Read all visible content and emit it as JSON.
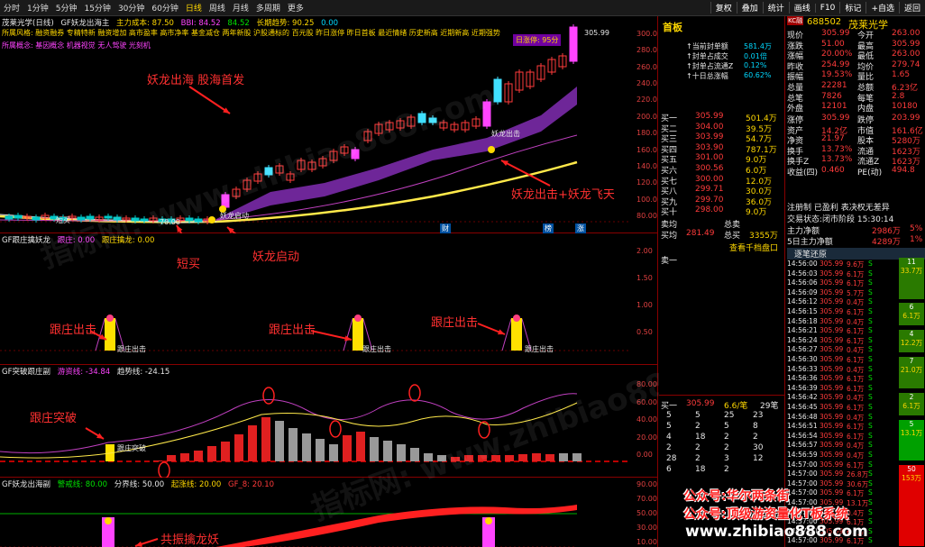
{
  "toolbar": {
    "periods": [
      "分时",
      "1分钟",
      "5分钟",
      "15分钟",
      "30分钟",
      "60分钟",
      "日线",
      "周线",
      "月线",
      "多周期",
      "更多"
    ],
    "active_period": "日线",
    "right_items": [
      "复权",
      "叠加",
      "统计",
      "画线",
      "F10",
      "标记",
      "+自选",
      "返回"
    ]
  },
  "main_panel": {
    "stock_label": "茂莱光学(日线)",
    "indicator_name": "GF妖龙出海主",
    "cost_label": "主力成本: 87.50",
    "bbi_label": "BBI: 84.52",
    "ma_value": "84.52",
    "trend_label": "长期趋势: 90.25",
    "trend_value": "0.00",
    "style_line": "所属风格: 融资融券 专精特新 融资增加 高市盈率 高市净率 基金减仓 两年新股 沪股通标的 百元股 昨日涨停 昨日首板 最近情绪 历史新高 近期新高 近期强势",
    "concept_line": "所属概念: 基因概念 机器视觉 无人驾驶 光刻机",
    "limit_badge": "日涨停: 95分",
    "y_ticks": [
      "300.0",
      "280.0",
      "260.0",
      "240.0",
      "220.0",
      "200.0",
      "180.0",
      "160.0",
      "140.0",
      "120.0",
      "100.0",
      "80.00"
    ],
    "peak_price": "305.99",
    "low_label": "70.00",
    "buy_mark": "短买",
    "start_mark": "妖龙启动",
    "strike_mark": "妖龙出击",
    "annotations": {
      "headline": "妖龙出海 股海首发",
      "short_buy": "短买",
      "dragon_start": "妖龙启动",
      "dragon_fly": "妖龙出击+妖龙飞天"
    },
    "bottom_markers": [
      "财",
      "榜",
      "涨"
    ]
  },
  "panel2": {
    "title": "GF跟庄擒妖龙",
    "sub1": "跟庄: 0.00",
    "sub2": "跟庄擒龙: 0.00",
    "y_ticks": [
      "2.00",
      "1.50",
      "1.00",
      "0.50"
    ],
    "bar_label": "跟庄出击",
    "annotation": "跟庄出击"
  },
  "panel3": {
    "title": "GF突破跟庄副",
    "sub1": "游资线: -34.84",
    "sub2": "趋势线: -24.15",
    "y_ticks": [
      "80.00",
      "60.00",
      "40.00",
      "20.00",
      "0.00"
    ],
    "bar_label": "跟庄突破",
    "annotation": "跟庄突破"
  },
  "panel4": {
    "title": "GF妖龙出海副",
    "sub1": "警戒线: 80.00",
    "sub2": "分界线: 50.00",
    "sub3": "起涨线: 20.00",
    "sub4": "GF_8: 20.10",
    "y_ticks": [
      "90.00",
      "70.00",
      "50.00",
      "30.00",
      "10.00"
    ],
    "annotation": "共振擒龙妖"
  },
  "quote": {
    "badge": "KC融",
    "code": "688502",
    "name": "茂莱光学",
    "tag": "首板",
    "stats": [
      {
        "label": "当前封单额",
        "value": "581.4万"
      },
      {
        "label": "封单占成交",
        "value": "0.01倍"
      },
      {
        "label": "封单占流通Z",
        "value": "0.12%"
      },
      {
        "label": "十日总涨幅",
        "value": "60.62%"
      }
    ],
    "sells": [
      {
        "label": "卖十",
        "price": "",
        "vol": ""
      },
      {
        "label": "卖九",
        "price": "",
        "vol": ""
      },
      {
        "label": "卖八",
        "price": "",
        "vol": ""
      },
      {
        "label": "卖七",
        "price": "",
        "vol": ""
      },
      {
        "label": "卖六",
        "price": "",
        "vol": ""
      },
      {
        "label": "卖五",
        "price": "",
        "vol": ""
      },
      {
        "label": "卖四",
        "price": "",
        "vol": ""
      },
      {
        "label": "卖三",
        "price": "",
        "vol": ""
      },
      {
        "label": "卖二",
        "price": "",
        "vol": ""
      }
    ],
    "buys": [
      {
        "label": "买一",
        "price": "305.99",
        "vol": "501.4万"
      },
      {
        "label": "买二",
        "price": "304.00",
        "vol": "39.5万"
      },
      {
        "label": "买三",
        "price": "303.99",
        "vol": "54.7万"
      },
      {
        "label": "买四",
        "price": "303.90",
        "vol": "787.1万"
      },
      {
        "label": "买五",
        "price": "301.00",
        "vol": "9.0万"
      },
      {
        "label": "买六",
        "price": "300.56",
        "vol": "6.0万"
      },
      {
        "label": "买七",
        "price": "300.00",
        "vol": "12.0万"
      },
      {
        "label": "买八",
        "price": "299.71",
        "vol": "30.0万"
      },
      {
        "label": "买九",
        "price": "299.70",
        "vol": "36.0万"
      },
      {
        "label": "买十",
        "price": "298.00",
        "vol": "9.0万"
      }
    ],
    "avg_sell": {
      "label": "卖均",
      "label2": "总卖",
      "value": ""
    },
    "avg_buy": {
      "label": "买均",
      "value": "281.49",
      "label2": "总买",
      "value2": "3355万"
    },
    "view_link": "查看千档盘口",
    "sell1_label": "卖一",
    "buy1_bottom": {
      "label": "买一",
      "price": "305.99",
      "ratio": "6.6/笔",
      "count": "29笔"
    },
    "queue": [
      [
        "5",
        "5",
        "25",
        "23"
      ],
      [
        "5",
        "2",
        "5",
        "8"
      ],
      [
        "4",
        "18",
        "2",
        "2"
      ],
      [
        "2",
        "2",
        "2",
        "30"
      ],
      [
        "28",
        "2",
        "3",
        "12"
      ],
      [
        "6",
        "18",
        "2",
        ""
      ]
    ]
  },
  "right": {
    "fields": [
      {
        "l1": "现价",
        "v1": "305.99",
        "l2": "今开",
        "v2": "263.00"
      },
      {
        "l1": "涨跌",
        "v1": "51.00",
        "l2": "最高",
        "v2": "305.99"
      },
      {
        "l1": "涨幅",
        "v1": "20.00%",
        "l2": "最低",
        "v2": "263.00"
      },
      {
        "l1": "昨收",
        "v1": "254.99",
        "l2": "均价",
        "v2": "279.74"
      },
      {
        "l1": "振幅",
        "v1": "19.53%",
        "l2": "量比",
        "v2": "1.65"
      },
      {
        "l1": "总量",
        "v1": "22281",
        "l2": "总额",
        "v2": "6.23亿"
      },
      {
        "l1": "总笔",
        "v1": "7826",
        "l2": "每笔",
        "v2": "2.8"
      },
      {
        "l1": "外盘",
        "v1": "12101",
        "l2": "内盘",
        "v2": "10180"
      }
    ],
    "fields2": [
      {
        "l1": "涨停",
        "v1": "305.99",
        "l2": "跌停",
        "v2": "203.99"
      },
      {
        "l1": "资产",
        "v1": "14.2亿",
        "l2": "市值",
        "v2": "161.6亿"
      },
      {
        "l1": "净资",
        "v1": "21.97",
        "l2": "股本",
        "v2": "5280万"
      },
      {
        "l1": "换手",
        "v1": "13.73%",
        "l2": "流通",
        "v2": "1623万"
      },
      {
        "l1": "换手Z",
        "v1": "13.73%",
        "l2": "流通Z",
        "v2": "1623万"
      },
      {
        "l1": "收益(四)",
        "v1": "0.460",
        "l2": "PE(动)",
        "v2": "494.8"
      }
    ],
    "reg_line": "注册制 已盈利 表决权无差异",
    "trade_state": "交易状态:闭市阶段 15:30:14",
    "main_net": {
      "label": "主力净额",
      "value": "2986万",
      "pct": "5%"
    },
    "main_net5": {
      "label": "5日主力净额",
      "value": "4289万",
      "pct": "1%"
    },
    "tick_title": "逐笔还原",
    "ticks": [
      [
        "14:56:00",
        "305.99",
        "9.6万",
        "S"
      ],
      [
        "14:56:03",
        "305.99",
        "6.1万",
        "S"
      ],
      [
        "14:56:06",
        "305.99",
        "6.1万",
        "S"
      ],
      [
        "14:56:09",
        "305.99",
        "5.7万",
        "S"
      ],
      [
        "14:56:12",
        "305.99",
        "0.4万",
        "S"
      ],
      [
        "14:56:15",
        "305.99",
        "6.1万",
        "S"
      ],
      [
        "14:56:18",
        "305.99",
        "0.4万",
        "S"
      ],
      [
        "14:56:21",
        "305.99",
        "6.1万",
        "S"
      ],
      [
        "14:56:24",
        "305.99",
        "6.1万",
        "S"
      ],
      [
        "14:56:27",
        "305.99",
        "0.4万",
        "S"
      ],
      [
        "14:56:30",
        "305.99",
        "6.1万",
        "S"
      ],
      [
        "14:56:33",
        "305.99",
        "0.4万",
        "S"
      ],
      [
        "14:56:36",
        "305.99",
        "6.1万",
        "S"
      ],
      [
        "14:56:39",
        "305.99",
        "6.1万",
        "S"
      ],
      [
        "14:56:42",
        "305.99",
        "0.4万",
        "S"
      ],
      [
        "14:56:45",
        "305.99",
        "6.1万",
        "S"
      ],
      [
        "14:56:48",
        "305.99",
        "0.4万",
        "S"
      ],
      [
        "14:56:51",
        "305.99",
        "6.1万",
        "S"
      ],
      [
        "14:56:54",
        "305.99",
        "6.1万",
        "S"
      ],
      [
        "14:56:57",
        "305.99",
        "0.4万",
        "S"
      ],
      [
        "14:56:59",
        "305.99",
        "0.4万",
        "S"
      ],
      [
        "14:57:00",
        "305.99",
        "6.1万",
        "S"
      ],
      [
        "14:57:00",
        "305.99",
        "26.8万",
        "S"
      ],
      [
        "14:57:00",
        "305.99",
        "30.6万",
        "S"
      ],
      [
        "14:57:00",
        "305.99",
        "6.1万",
        "S"
      ],
      [
        "14:57:00",
        "305.99",
        "13.1万",
        "S"
      ],
      [
        "14:57:00",
        "305.99",
        "0.4万",
        "S"
      ],
      [
        "14:57:00",
        "305.99",
        "6.1万",
        "S"
      ],
      [
        "14:57:00",
        "305.99",
        "6.1万",
        "S"
      ],
      [
        "14:57:00",
        "305.99",
        "6.1万",
        "S"
      ]
    ],
    "tick_sizes": [
      "2",
      "2",
      "5",
      "2",
      "2",
      "2",
      "2",
      "2",
      "2",
      "2",
      "2",
      "2",
      "2",
      "2",
      "2",
      "2",
      "2",
      "2",
      "2",
      "2",
      "2",
      "2",
      "2",
      "2",
      "2",
      "2",
      "2",
      "2",
      "2",
      "2"
    ],
    "side_bars": [
      {
        "top": "11",
        "sub": "33.7万"
      },
      {
        "top": "6",
        "sub": "6.1万"
      },
      {
        "top": "4",
        "sub": "12.2万"
      },
      {
        "top": "7",
        "sub": "21.0万"
      },
      {
        "top": "2",
        "sub": "6.1万"
      },
      {
        "top": "5",
        "sub": "13.1万"
      },
      {
        "top": "50",
        "sub": "153万"
      }
    ]
  },
  "watermark": {
    "site": "指标网: www.zhibiao888.com",
    "gzh1": "公众号:华尔两条街",
    "gzh2": "公众号:顶级游资量化T板系统",
    "url": "www.zhibiao888.com"
  },
  "colors": {
    "up": "#ff3b3b",
    "down": "#00e000",
    "accent": "#ffd800",
    "bg": "#000000"
  }
}
